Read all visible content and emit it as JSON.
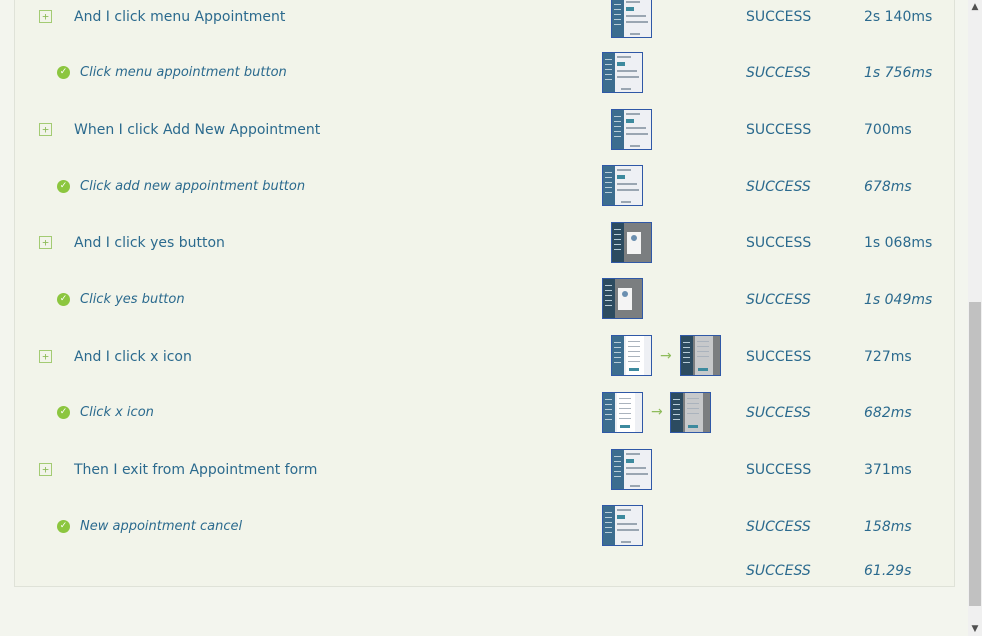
{
  "rows": [
    {
      "type": "step",
      "label": "And I click menu Appointment",
      "status": "SUCCESS",
      "duration": "2s 140ms",
      "thumbs": [
        "list"
      ]
    },
    {
      "type": "sub",
      "label": "Click menu appointment button",
      "status": "SUCCESS",
      "duration": "1s 756ms",
      "thumbs": [
        "list"
      ]
    },
    {
      "type": "step",
      "label": "When I click Add New Appointment",
      "status": "SUCCESS",
      "duration": "700ms",
      "thumbs": [
        "list"
      ]
    },
    {
      "type": "sub",
      "label": "Click add new appointment button",
      "status": "SUCCESS",
      "duration": "678ms",
      "thumbs": [
        "list"
      ]
    },
    {
      "type": "step",
      "label": "And I click yes button",
      "status": "SUCCESS",
      "duration": "1s 068ms",
      "thumbs": [
        "modal"
      ]
    },
    {
      "type": "sub",
      "label": "Click yes button",
      "status": "SUCCESS",
      "duration": "1s 049ms",
      "thumbs": [
        "modal"
      ]
    },
    {
      "type": "step",
      "label": "And I click x icon",
      "status": "SUCCESS",
      "duration": "727ms",
      "thumbs": [
        "form",
        "formdark"
      ]
    },
    {
      "type": "sub",
      "label": "Click x icon",
      "status": "SUCCESS",
      "duration": "682ms",
      "thumbs": [
        "form",
        "formdark"
      ]
    },
    {
      "type": "step",
      "label": "Then I exit from Appointment form",
      "status": "SUCCESS",
      "duration": "371ms",
      "thumbs": [
        "list"
      ]
    },
    {
      "type": "sub",
      "label": "New appointment cancel",
      "status": "SUCCESS",
      "duration": "158ms",
      "thumbs": [
        "list"
      ]
    }
  ],
  "total": {
    "status": "SUCCESS",
    "duration": "61.29s"
  },
  "icons": {
    "expand": "plus-square-icon",
    "check": "check-circle-icon",
    "arrow": "arrow-right-icon"
  },
  "colors": {
    "text": "#2b6a8e",
    "success_green": "#8cc63f",
    "thumb_border": "#2f58a7"
  }
}
